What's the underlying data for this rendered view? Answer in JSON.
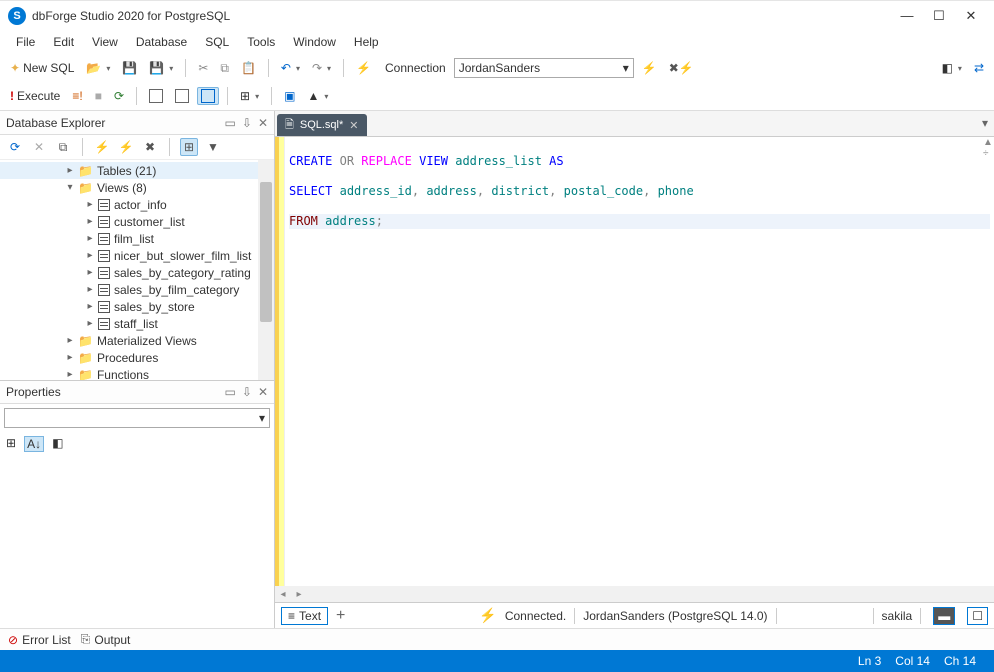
{
  "app": {
    "title": "dbForge Studio 2020 for PostgreSQL",
    "icon_letter": "S"
  },
  "menu": [
    "File",
    "Edit",
    "View",
    "Database",
    "SQL",
    "Tools",
    "Window",
    "Help"
  ],
  "toolbar1": {
    "new_sql": "New SQL",
    "connection_label": "Connection",
    "connection_value": "JordanSanders"
  },
  "toolbar2": {
    "execute": "Execute"
  },
  "db_explorer": {
    "title": "Database Explorer",
    "tree": [
      {
        "indent": 60,
        "tw": "▸",
        "type": "folder",
        "label": "Tables (21)",
        "selected": true
      },
      {
        "indent": 60,
        "tw": "▾",
        "type": "folder",
        "label": "Views (8)"
      },
      {
        "indent": 80,
        "tw": "▸",
        "type": "view",
        "label": "actor_info"
      },
      {
        "indent": 80,
        "tw": "▸",
        "type": "view",
        "label": "customer_list"
      },
      {
        "indent": 80,
        "tw": "▸",
        "type": "view",
        "label": "film_list"
      },
      {
        "indent": 80,
        "tw": "▸",
        "type": "view",
        "label": "nicer_but_slower_film_list"
      },
      {
        "indent": 80,
        "tw": "▸",
        "type": "view",
        "label": "sales_by_category_rating"
      },
      {
        "indent": 80,
        "tw": "▸",
        "type": "view",
        "label": "sales_by_film_category"
      },
      {
        "indent": 80,
        "tw": "▸",
        "type": "view",
        "label": "sales_by_store"
      },
      {
        "indent": 80,
        "tw": "▸",
        "type": "view",
        "label": "staff_list"
      },
      {
        "indent": 60,
        "tw": "▸",
        "type": "folder",
        "label": "Materialized Views"
      },
      {
        "indent": 60,
        "tw": "▸",
        "type": "folder",
        "label": "Procedures"
      },
      {
        "indent": 60,
        "tw": "▸",
        "type": "folder",
        "label": "Functions"
      }
    ]
  },
  "properties": {
    "title": "Properties"
  },
  "doc": {
    "tab_label": "SQL.sql*",
    "sql": {
      "l1": {
        "create": "CREATE",
        "or": "OR",
        "replace": "REPLACE",
        "view": "VIEW",
        "name": "address_list",
        "as": "AS"
      },
      "l2": {
        "select": "SELECT",
        "c1": "address_id",
        "c2": "address",
        "c3": "district",
        "c4": "postal_code",
        "c5": "phone",
        "comma": ","
      },
      "l3": {
        "from": "FROM",
        "table": "address",
        "semi": ";"
      }
    }
  },
  "docstrip": {
    "text_tab": "Text",
    "connected": "Connected.",
    "connection_info": "JordanSanders (PostgreSQL 14.0)",
    "db": "sakila"
  },
  "bottom_tabs": {
    "error_list": "Error List",
    "output": "Output"
  },
  "status": {
    "ln": "Ln 3",
    "col": "Col 14",
    "ch": "Ch 14"
  }
}
